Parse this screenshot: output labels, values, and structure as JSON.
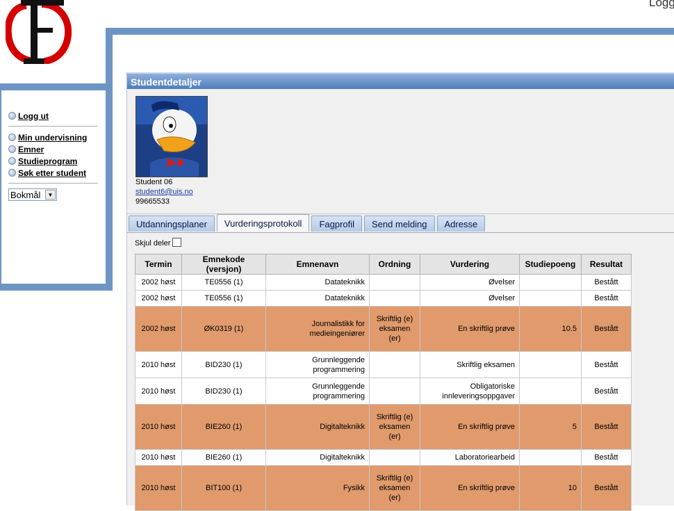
{
  "header": {
    "logout_corner": "Logg"
  },
  "sidebar": {
    "logout": "Logg ut",
    "items": [
      "Min undervisning",
      "Emner",
      "Studieprogram",
      "Søk etter student"
    ],
    "language": "Bokmål"
  },
  "panel": {
    "title": "Studentdetaljer"
  },
  "student": {
    "name": "Student 06",
    "email": "student6@uis.no",
    "phone": "99665533"
  },
  "tabs": [
    "Utdanningsplaner",
    "Vurderingsprotokoll",
    "Fagprofil",
    "Send melding",
    "Adresse"
  ],
  "active_tab": "Vurderingsprotokoll",
  "hide_parts_label": "Skjul deler",
  "table": {
    "headers": [
      "Termin",
      "Emnekode (versjon)",
      "Emnenavn",
      "Ordning",
      "Vurdering",
      "Studiepoeng",
      "Resultat"
    ],
    "rows": [
      {
        "termin": "2002 høst",
        "kode": "TE0556 (1)",
        "navn": "Datateknikk",
        "ordning": "",
        "vurdering": "Øvelser",
        "poeng": "",
        "resultat": "Bestått",
        "highlight": false
      },
      {
        "termin": "2002 høst",
        "kode": "TE0556 (1)",
        "navn": "Datateknikk",
        "ordning": "",
        "vurdering": "Øvelser",
        "poeng": "",
        "resultat": "Bestått",
        "highlight": false
      },
      {
        "termin": "2002 høst",
        "kode": "ØK0319 (1)",
        "navn": "Journalistikk for medieingeniører",
        "ordning": "Skriftlig (e) eksamen (er)",
        "vurdering": "En skriftlig prøve",
        "poeng": "10.5",
        "resultat": "Bestått",
        "highlight": true
      },
      {
        "termin": "2010 høst",
        "kode": "BID230 (1)",
        "navn": "Grunnleggende programmering",
        "ordning": "",
        "vurdering": "Skriftlig eksamen",
        "poeng": "",
        "resultat": "Bestått",
        "highlight": false
      },
      {
        "termin": "2010 høst",
        "kode": "BID230 (1)",
        "navn": "Grunnleggende programmering",
        "ordning": "",
        "vurdering": "Obligatoriske innleveringsoppgaver",
        "poeng": "",
        "resultat": "Bestått",
        "highlight": false
      },
      {
        "termin": "2010 høst",
        "kode": "BIE260 (1)",
        "navn": "Digitalteknikk",
        "ordning": "Skriftlig (e) eksamen (er)",
        "vurdering": "En skriftlig prøve",
        "poeng": "5",
        "resultat": "Bestått",
        "highlight": true
      },
      {
        "termin": "2010 høst",
        "kode": "BIE260 (1)",
        "navn": "Digitalteknikk",
        "ordning": "",
        "vurdering": "Laboratoriearbeid",
        "poeng": "",
        "resultat": "Bestått",
        "highlight": false
      },
      {
        "termin": "2010 høst",
        "kode": "BIT100 (1)",
        "navn": "Fysikk",
        "ordning": "Skriftlig (e) eksamen (er)",
        "vurdering": "En skriftlig prøve",
        "poeng": "10",
        "resultat": "Bestått",
        "highlight": true
      }
    ]
  }
}
